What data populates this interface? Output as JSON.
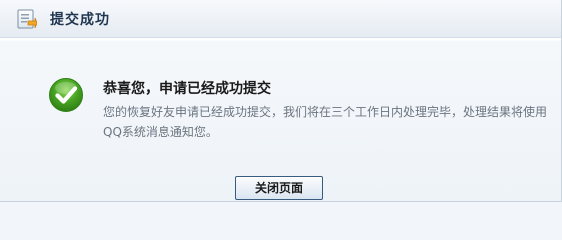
{
  "window": {
    "title": "提交成功"
  },
  "content": {
    "heading": "恭喜您，申请已经成功提交",
    "message": "您的恢复好友申请已经成功提交，我们将在三个工作日内处理完毕，处理结果将使用QQ系统消息通知您。"
  },
  "actions": {
    "close_label": "关闭页面"
  },
  "icons": {
    "title": "form-icon",
    "status": "success-check-icon"
  },
  "colors": {
    "success_green": "#3c9b1f",
    "title_text": "#1f3550",
    "button_border": "#385b80"
  }
}
